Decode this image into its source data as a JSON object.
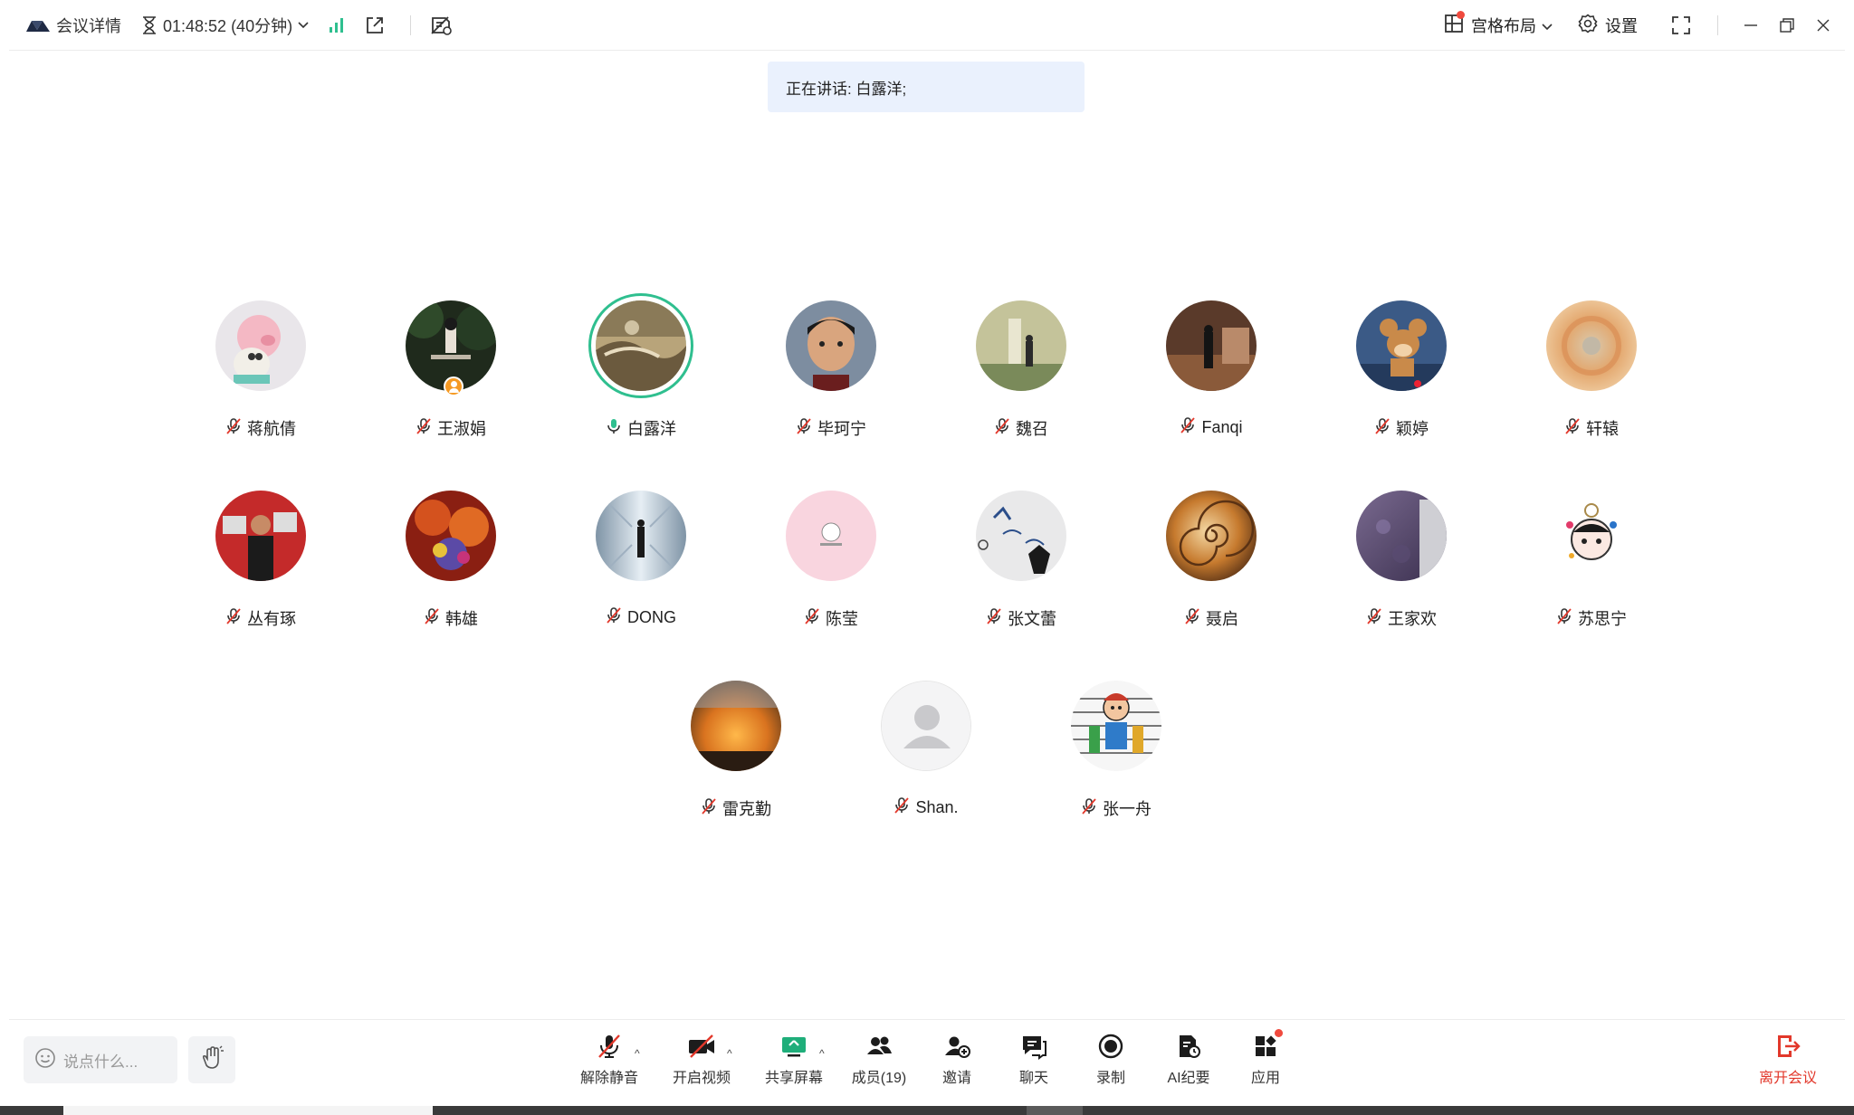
{
  "topbar": {
    "meeting_details": "会议详情",
    "timer": "01:48:52 (40分钟)",
    "layout_label": "宫格布局",
    "settings_label": "设置"
  },
  "speaking_banner": "正在讲话: 白露洋;",
  "colors": {
    "accent_green": "#2fbf8f",
    "leave_red": "#e2382b",
    "notification_red": "#f04a3e",
    "banner_bg": "#eaf1fd"
  },
  "participants": [
    {
      "name": "蒋航倩",
      "muted": true
    },
    {
      "name": "王淑娟",
      "muted": true,
      "host": true
    },
    {
      "name": "白露洋",
      "muted": false,
      "speaking": true
    },
    {
      "name": "毕珂宁",
      "muted": true
    },
    {
      "name": "魏召",
      "muted": true
    },
    {
      "name": "Fanqi",
      "muted": true
    },
    {
      "name": "颖婷",
      "muted": true
    },
    {
      "name": "轩辕",
      "muted": true
    },
    {
      "name": "丛有琢",
      "muted": true
    },
    {
      "name": "韩雄",
      "muted": true
    },
    {
      "name": "DONG",
      "muted": true
    },
    {
      "name": "陈莹",
      "muted": true
    },
    {
      "name": "张文蕾",
      "muted": true
    },
    {
      "name": "聂启",
      "muted": true
    },
    {
      "name": "王家欢",
      "muted": true
    },
    {
      "name": "苏思宁",
      "muted": true
    },
    {
      "name": "雷克勤",
      "muted": true
    },
    {
      "name": "Shan.",
      "muted": true
    },
    {
      "name": "张一舟",
      "muted": true
    }
  ],
  "bottombar": {
    "chat_placeholder": "说点什么...",
    "unmute": "解除静音",
    "start_video": "开启视频",
    "share_screen": "共享屏幕",
    "members": "成员(19)",
    "invite": "邀请",
    "chat": "聊天",
    "record": "录制",
    "ai_minutes": "AI纪要",
    "apps": "应用",
    "leave": "离开会议"
  }
}
